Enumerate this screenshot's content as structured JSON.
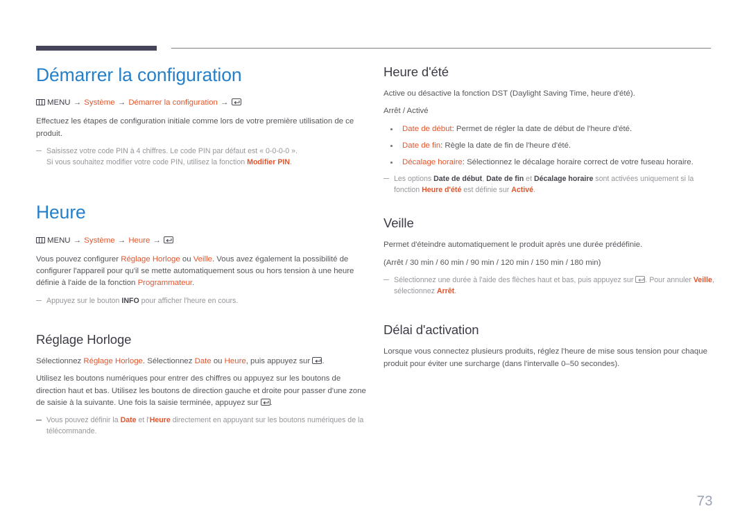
{
  "page": {
    "number": "73",
    "accent_color": "#e2552c",
    "title_color": "#2680c9",
    "heading_color": "#3c3b45",
    "body_color": "#55565b",
    "note_color": "#96969b",
    "rule_color": "#46445a"
  },
  "left": {
    "section1": {
      "title": "Démarrer la configuration",
      "menupath": {
        "menu_label": "MENU",
        "arrow": "→",
        "step1": "Système",
        "step2": "Démarrer la configuration",
        "enter_icon": "enter-key-icon",
        "menu_icon": "menu-icon"
      },
      "paragraph": "Effectuez les étapes de configuration initiale comme lors de votre première utilisation de ce produit.",
      "note_line1_a": "Saisissez votre code PIN à 4 chiffres. Le code PIN par défaut est « 0-0-0-0 ».",
      "note_line2_a": "Si vous souhaitez modifier votre code PIN, utilisez la fonction ",
      "note_line2_b": "Modifier PIN",
      "note_line2_c": "."
    },
    "section2": {
      "title": "Heure",
      "menupath": {
        "menu_label": "MENU",
        "arrow": "→",
        "step1": "Système",
        "step2": "Heure",
        "enter_icon": "enter-key-icon",
        "menu_icon": "menu-icon"
      },
      "para_a": "Vous pouvez configurer ",
      "para_b": "Réglage Horloge",
      "para_c": " ou ",
      "para_d": "Veille",
      "para_e": ". Vous avez également la possibilité de configurer l'appareil pour qu'il se mette automatiquement sous ou hors tension à une heure définie à l'aide de la fonction ",
      "para_f": "Programmateur",
      "para_g": ".",
      "note_a": "Appuyez sur le bouton ",
      "note_b": "INFO",
      "note_c": " pour afficher l'heure en cours."
    },
    "section3": {
      "title": "Réglage Horloge",
      "para1_a": "Sélectionnez ",
      "para1_b": "Réglage Horloge",
      "para1_c": ". Sélectionnez ",
      "para1_d": "Date",
      "para1_e": " ou ",
      "para1_f": "Heure",
      "para1_g": ", puis appuyez sur ",
      "para1_h": ".",
      "para2": "Utilisez les boutons numériques pour entrer des chiffres ou appuyez sur les boutons de direction haut et bas. Utilisez les boutons de direction gauche et droite pour passer d'une zone de saisie à la suivante. Une fois la saisie terminée, appuyez sur ",
      "para2_end": ".",
      "note_a": "Vous pouvez définir la ",
      "note_b": "Date",
      "note_c": " et l'",
      "note_d": "Heure",
      "note_e": " directement en appuyant sur les boutons numériques de la télécommande."
    }
  },
  "right": {
    "section1": {
      "title": "Heure d'été",
      "paragraph": "Active ou désactive la fonction DST (Daylight Saving Time, heure d'été).",
      "options": "Arrêt / Activé",
      "bullets": [
        {
          "term": "Date de début",
          "desc": ": Permet de régler la date de début de l'heure d'été."
        },
        {
          "term": "Date de fin",
          "desc": ": Règle la date de fin de l'heure d'été."
        },
        {
          "term": "Décalage horaire",
          "desc": ": Sélectionnez le décalage horaire correct de votre fuseau horaire."
        }
      ],
      "note_a": "Les options ",
      "note_b": "Date de début",
      "note_c": ", ",
      "note_d": "Date de fin",
      "note_e": " et ",
      "note_f": "Décalage horaire",
      "note_g": " sont activées uniquement si la fonction ",
      "note_h": "Heure d'été",
      "note_i": " est définie sur ",
      "note_j": "Activé",
      "note_k": "."
    },
    "section2": {
      "title": "Veille",
      "paragraph": "Permet d'éteindre automatiquement le produit après une durée prédéfinie.",
      "options": "(Arrêt / 30 min / 60 min / 90 min / 120 min / 150 min / 180 min)",
      "note_a": "Sélectionnez une durée à l'aide des flèches haut et bas, puis appuyez sur ",
      "note_b": ". Pour annuler ",
      "note_c": "Veille",
      "note_d": ", sélectionnez ",
      "note_e": "Arrêt",
      "note_f": "."
    },
    "section3": {
      "title": "Délai d'activation",
      "paragraph": "Lorsque vous connectez plusieurs produits, réglez l'heure de mise sous tension pour chaque produit pour éviter une surcharge (dans l'intervalle 0–50 secondes)."
    }
  }
}
